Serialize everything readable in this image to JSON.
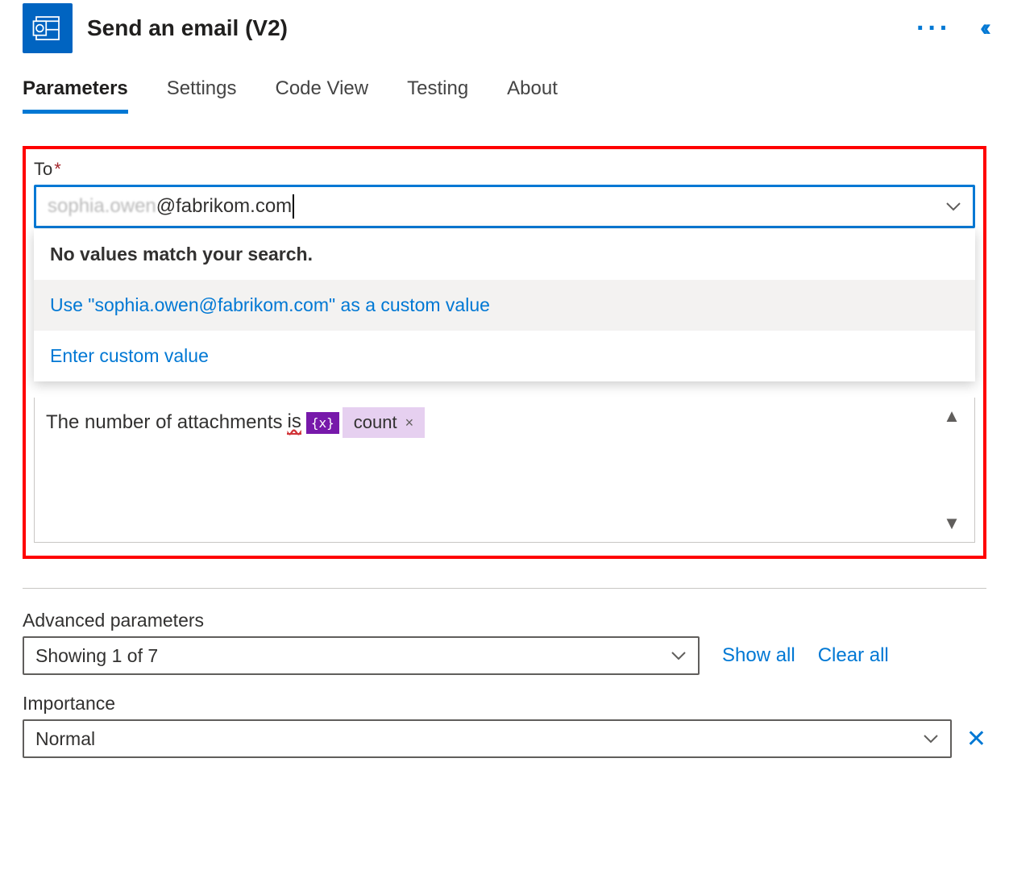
{
  "header": {
    "title": "Send an email (V2)"
  },
  "tabs": {
    "parameters": "Parameters",
    "settings": "Settings",
    "codeview": "Code View",
    "testing": "Testing",
    "about": "About"
  },
  "to_field": {
    "label": "To",
    "value_grey": "sophia.owen",
    "value_rest": "@fabrikom.com"
  },
  "dropdown": {
    "no_match": "No values match your search.",
    "use_custom": "Use \"sophia.owen@fabrikom.com\" as a custom value",
    "enter_custom": "Enter custom value"
  },
  "body": {
    "prefix": "The number of attachments ",
    "is_word": "is",
    "fx_symbol": "{x}",
    "token_label": "count"
  },
  "advanced": {
    "heading": "Advanced parameters",
    "showing": "Showing 1 of 7",
    "show_all": "Show all",
    "clear_all": "Clear all"
  },
  "importance": {
    "label": "Importance",
    "value": "Normal"
  }
}
